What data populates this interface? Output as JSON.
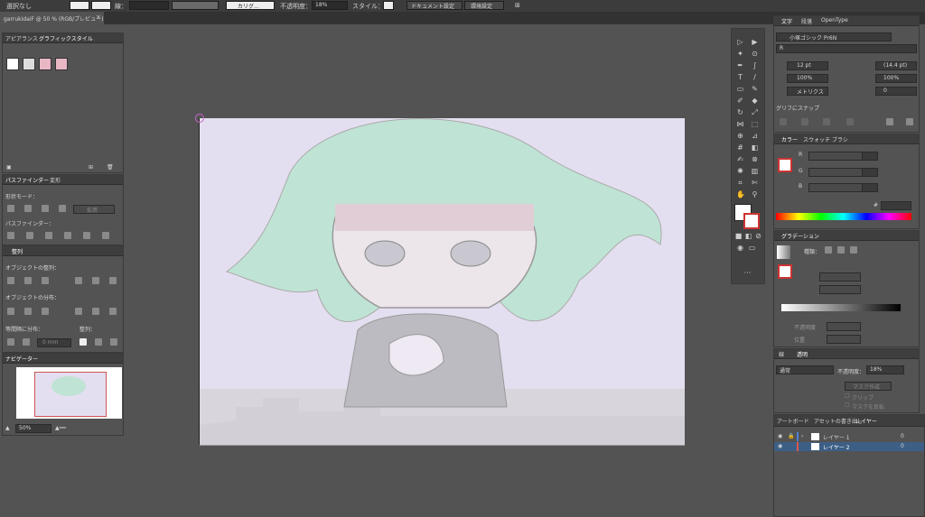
{
  "control_bar": {
    "selection": "選択なし",
    "stroke_label": "線：",
    "brush": "カリグ...",
    "opacity_label": "不透明度：",
    "opacity_value": "18%",
    "style_label": "スタイル：",
    "doc_settings": "ドキュメント設定",
    "preferences": "環境設定"
  },
  "document_tab": {
    "title": "garrukidaiF @ 50 % (RGB/プレビュー)",
    "close": "×"
  },
  "left_panels": {
    "appearance_tab": "アピアランス",
    "graphic_styles_tab": "グラフィックスタイル",
    "pathfinder_tab": "パスファインダー",
    "transform_tab": "変形",
    "shape_modes": "形状モード：",
    "expand": "拡張",
    "pathfinders": "パスファインダー：",
    "align_tab": "整列",
    "align_objects": "オブジェクトの整列：",
    "distribute_objects": "オブジェクトの分布：",
    "distribute_spacing": "等間隔に分布：",
    "align_to": "整列：",
    "spacing_value": "0 mm",
    "navigator_tab": "ナビゲーター",
    "zoom_value": "50%"
  },
  "right_panels": {
    "character_tab": "文字",
    "paragraph_tab": "段落",
    "opentype_tab": "OpenType",
    "font_family": "小塚ゴシック Pr6N",
    "font_style": "R",
    "font_size": "12 pt",
    "leading": "(14.4 pt)",
    "hscale": "100%",
    "vscale": "100%",
    "kerning": "メトリクス",
    "tracking": "0",
    "snap_to_glyph": "グリフにスナップ",
    "color_tab": "カラー",
    "swatches_tab": "スウォッチ",
    "brushes_tab": "ブラシ",
    "r_label": "R",
    "g_label": "G",
    "b_label": "B",
    "hex_label": "#",
    "gradient_tab": "グラデーション",
    "gradient_type": "種類：",
    "opacity_sub": "不透明度",
    "position_sub": "位置",
    "transparency_short": "線",
    "transparency_tab": "透明",
    "blend_mode": "通常",
    "opacity_label": "不透明度：",
    "opacity_value": "18%",
    "make_mask": "マスク作成",
    "clip": "クリップ",
    "invert_mask": "マスクを反転",
    "artboards_tab": "アートボード",
    "asset_export_tab": "アセットの書き出し",
    "layers_tab": "レイヤー",
    "layers": [
      {
        "name": "レイヤー 1",
        "count": "0"
      },
      {
        "name": "レイヤー 2",
        "count": "0"
      }
    ]
  },
  "colors": {
    "background": "#535353",
    "artboard": "#e4dff0",
    "layer_selected": "#3d5f86",
    "layer1_color": "#4f7fd8",
    "layer2_color": "#e0564f"
  }
}
